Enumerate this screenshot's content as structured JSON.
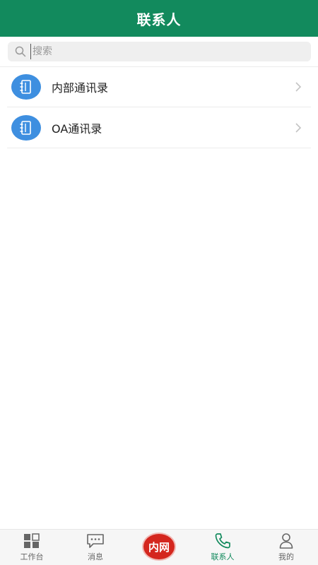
{
  "header": {
    "title": "联系人"
  },
  "search": {
    "placeholder": "搜索",
    "value": ""
  },
  "contacts": {
    "items": [
      {
        "label": "内部通讯录",
        "icon": "address-book-icon"
      },
      {
        "label": "OA通讯录",
        "icon": "address-book-icon"
      }
    ]
  },
  "tabbar": {
    "items": [
      {
        "label": "工作台",
        "icon": "grid-icon",
        "active": false
      },
      {
        "label": "消息",
        "icon": "chat-icon",
        "active": false
      },
      {
        "label": "内网",
        "icon": "intranet-button",
        "active": false
      },
      {
        "label": "联系人",
        "icon": "phone-icon",
        "active": true
      },
      {
        "label": "我的",
        "icon": "user-icon",
        "active": false
      }
    ]
  },
  "colors": {
    "brand_green": "#128a5d",
    "avatar_blue": "#3e8fe0",
    "center_red": "#d4261e"
  }
}
